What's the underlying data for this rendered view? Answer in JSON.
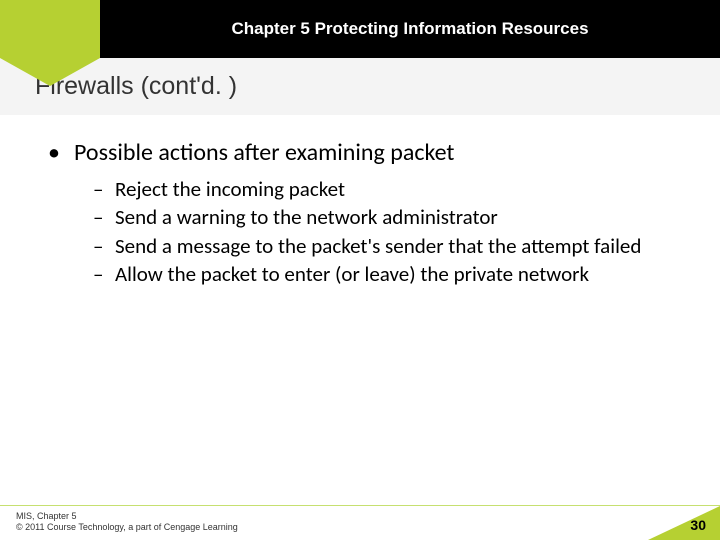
{
  "header": {
    "chapter_title": "Chapter 5 Protecting Information Resources"
  },
  "slide": {
    "title": "Firewalls (cont'd. )"
  },
  "body": {
    "bullet1": "Possible actions after examining packet",
    "sub": [
      "Reject the incoming packet",
      "Send a warning to the network administrator",
      "Send a message to the packet's sender that the attempt failed",
      "Allow the packet to enter (or leave) the private network"
    ]
  },
  "footer": {
    "line1": "MIS, Chapter 5",
    "line2": "© 2011 Course Technology, a part of Cengage Learning",
    "page": "30"
  }
}
